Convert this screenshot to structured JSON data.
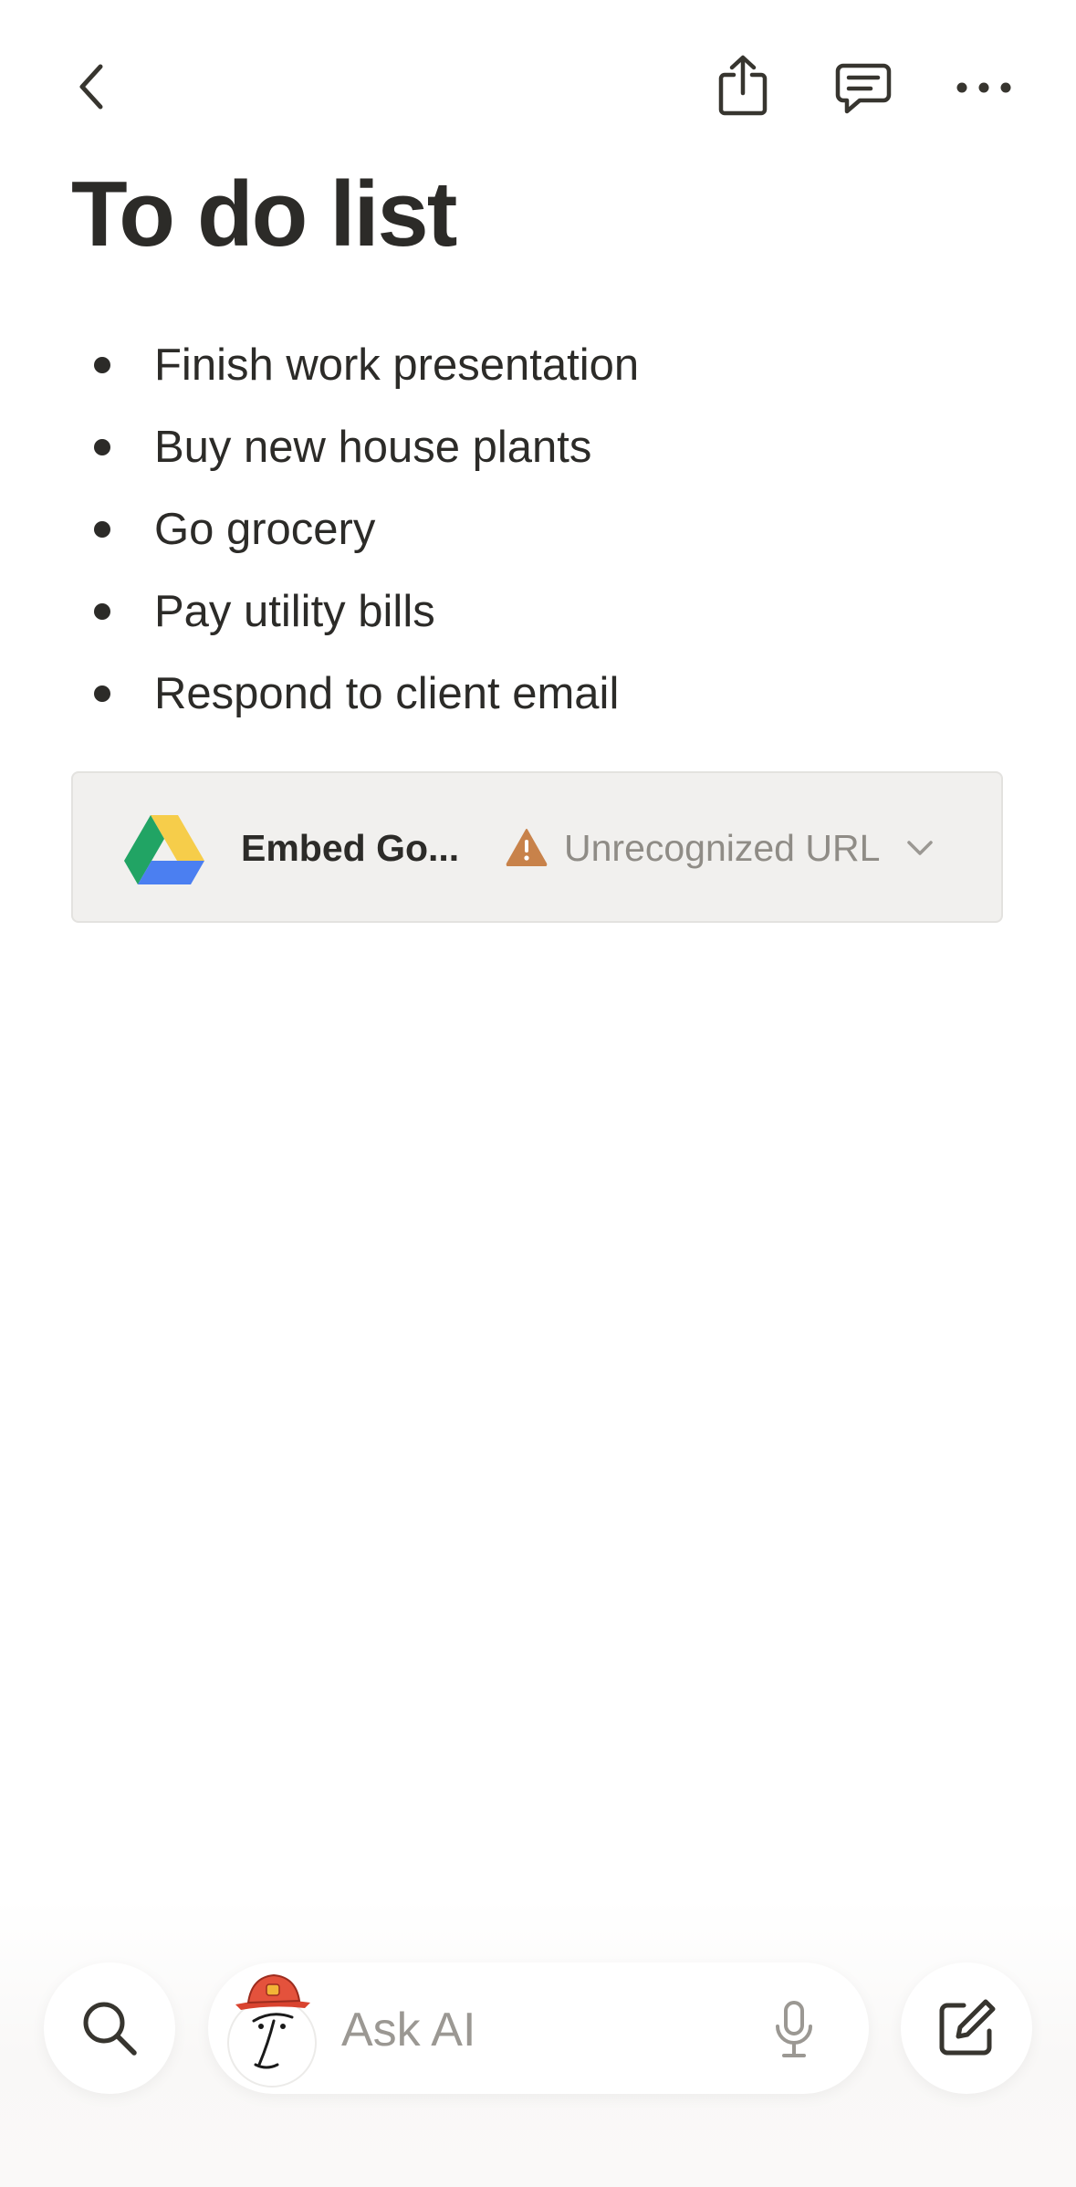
{
  "header": {
    "back_icon": "chevron-left-icon",
    "share_icon": "share-icon",
    "comment_icon": "comment-icon",
    "more_icon": "more-horizontal-icon"
  },
  "page": {
    "title": "To do list",
    "items": [
      "Finish work presentation",
      "Buy new house plants",
      "Go grocery",
      "Pay utility bills",
      "Respond to client email"
    ]
  },
  "embed": {
    "icon": "google-drive-icon",
    "title": "Embed Go...",
    "status_icon": "warning-icon",
    "status_text": "Unrecognized URL",
    "status_color": "#c8824a"
  },
  "bottom_bar": {
    "search_icon": "search-icon",
    "ask_ai_placeholder": "Ask AI",
    "mic_icon": "microphone-icon",
    "compose_icon": "compose-icon"
  }
}
